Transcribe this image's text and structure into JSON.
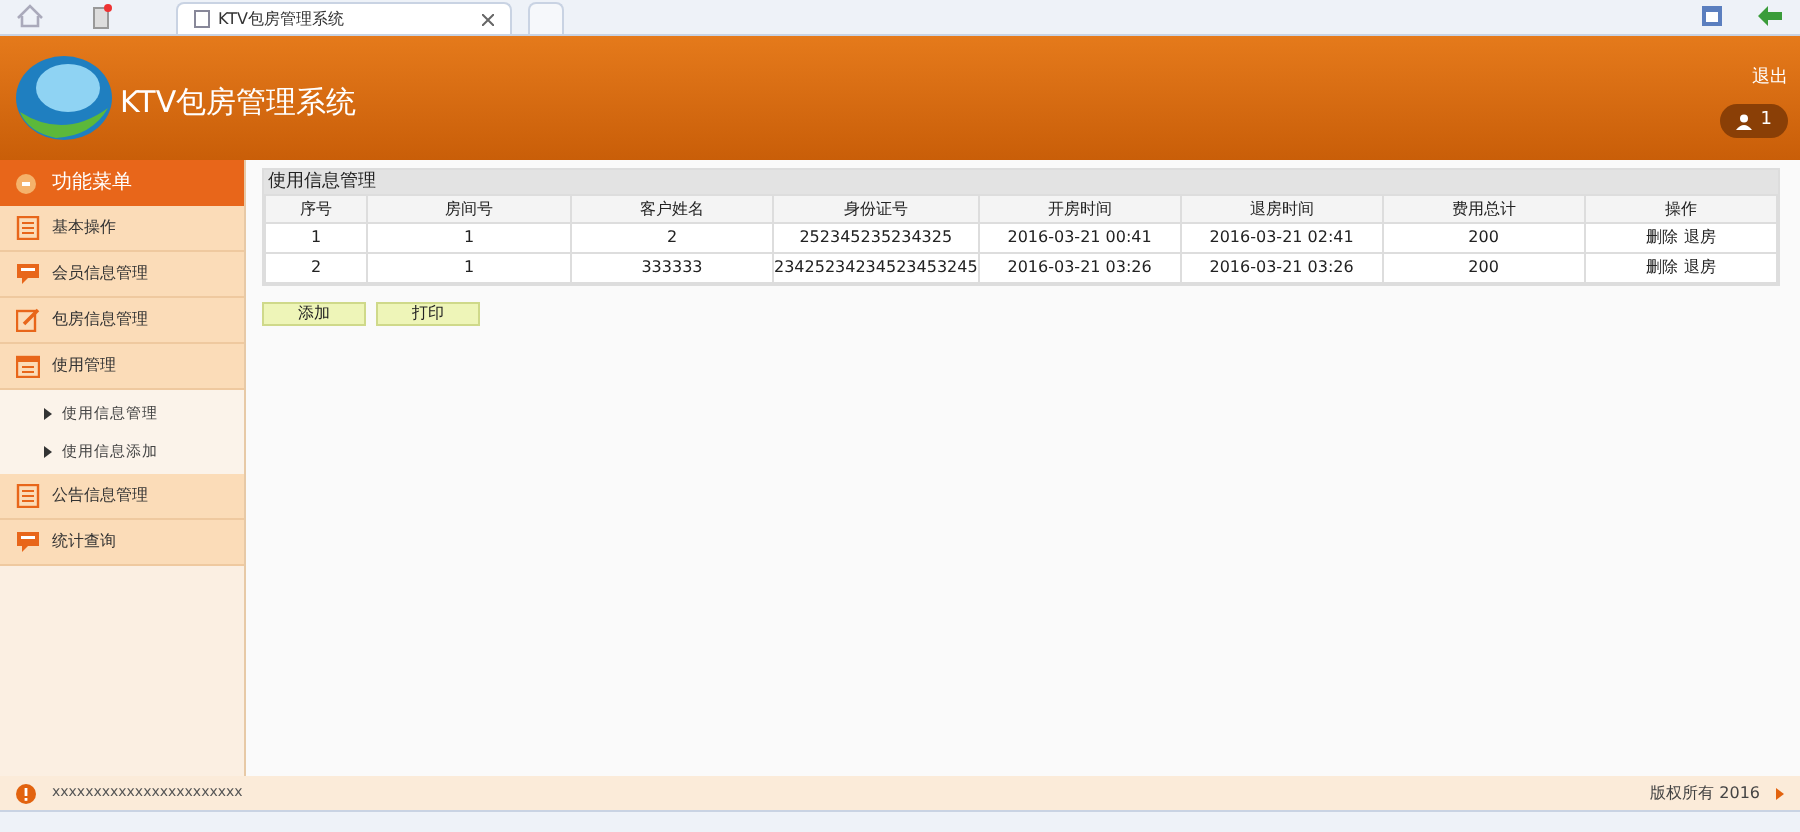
{
  "browser": {
    "tab_title": "KTV包房管理系统"
  },
  "header": {
    "title": "KTV包房管理系统",
    "logout": "退出",
    "user_count": "1"
  },
  "sidebar": {
    "title": "功能菜单",
    "items": [
      {
        "label": "基本操作",
        "kind": "list"
      },
      {
        "label": "会员信息管理",
        "kind": "chat"
      },
      {
        "label": "包房信息管理",
        "kind": "edit"
      },
      {
        "label": "使用管理",
        "kind": "calendar",
        "children": [
          {
            "label": "使用信息管理"
          },
          {
            "label": "使用信息添加"
          }
        ]
      },
      {
        "label": "公告信息管理",
        "kind": "list"
      },
      {
        "label": "统计查询",
        "kind": "chat"
      }
    ]
  },
  "panel": {
    "title": "使用信息管理",
    "table": {
      "columns": [
        "序号",
        "房间号",
        "客户姓名",
        "身份证号",
        "开房时间",
        "退房时间",
        "费用总计",
        "操作"
      ],
      "rows": [
        [
          "1",
          "1",
          "2",
          "252345235234325",
          "2016-03-21 00:41",
          "2016-03-21 02:41",
          "200",
          [
            "删除",
            "退房"
          ]
        ],
        [
          "2",
          "1",
          "333333",
          "23425234234523453245",
          "2016-03-21 03:26",
          "2016-03-21 03:26",
          "200",
          [
            "删除",
            "退房"
          ]
        ]
      ]
    },
    "buttons": [
      "添加",
      "打印"
    ]
  },
  "footer": {
    "message": "xxxxxxxxxxxxxxxxxxxxxxx",
    "copyright": "版权所有 2016"
  }
}
